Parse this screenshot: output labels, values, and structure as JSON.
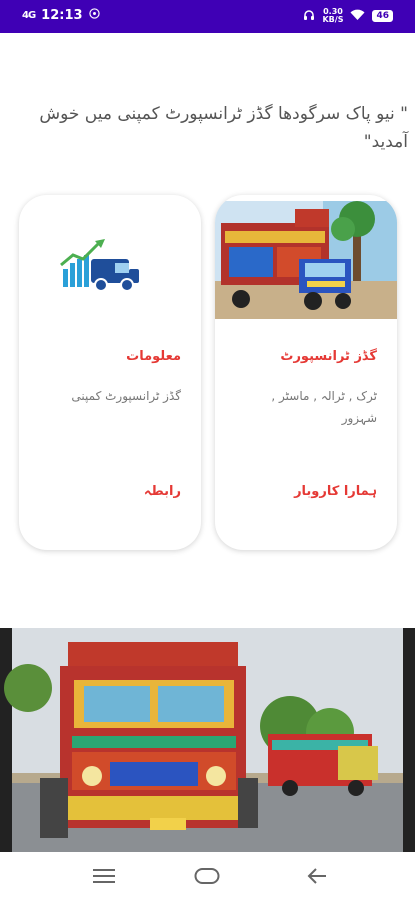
{
  "status_bar": {
    "time": "12:13",
    "signal": "4G",
    "net_speed": "0.30",
    "net_unit": "KB/S",
    "battery": "46"
  },
  "welcome_text": "\" نیو پاک سرگودھا گڈز ٹرانسپورٹ کمپنی میں خوش آمدید\"",
  "cards": [
    {
      "title": "گڈز ٹرانسپورٹ",
      "description": "ٹرک , ٹرالہ , ماسٹر , شہزور",
      "link": "ہمارا کاروبار"
    },
    {
      "title": "معلومات",
      "description": "گڈز ٹرانسپورٹ کمپنی",
      "link": "رابطہ"
    }
  ],
  "colors": {
    "status_bar": "#3f00b5",
    "accent_red": "#e53935"
  }
}
